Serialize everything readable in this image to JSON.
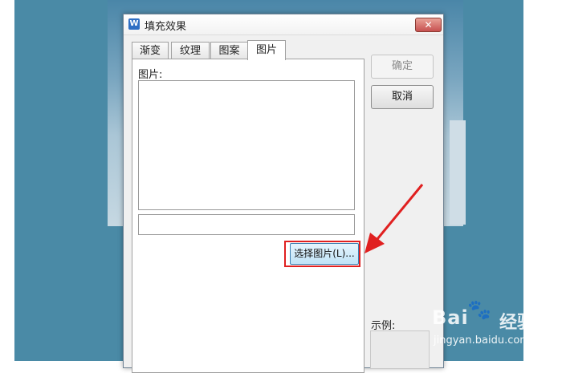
{
  "dialog": {
    "icon_glyph": "W",
    "title": "填充效果",
    "close_glyph": "✕"
  },
  "tabs": [
    {
      "label": "渐变",
      "active": false
    },
    {
      "label": "纹理",
      "active": false
    },
    {
      "label": "图案",
      "active": false
    },
    {
      "label": "图片",
      "active": true
    }
  ],
  "panel": {
    "picture_label": "图片:",
    "select_button_label": "选择图片(L)..."
  },
  "buttons": {
    "ok_label": "确定",
    "cancel_label": "取消"
  },
  "example_label": "示例:",
  "annotation": {
    "color": "#e02020"
  },
  "watermark": {
    "brand": "Bai",
    "paw": "🐾",
    "jingyan": "经验",
    "url": "jingyan.baidu.com"
  }
}
